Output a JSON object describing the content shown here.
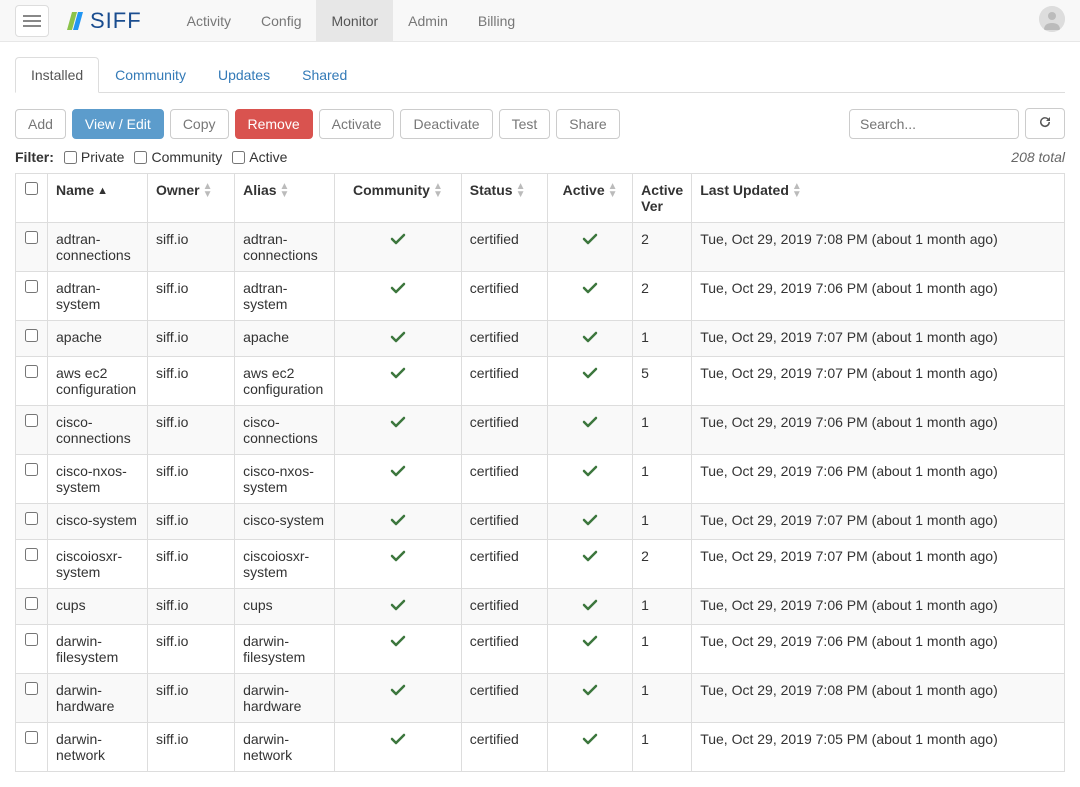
{
  "nav": {
    "items": [
      "Activity",
      "Config",
      "Monitor",
      "Admin",
      "Billing"
    ],
    "active": "Monitor",
    "brand": "SIFF"
  },
  "tabs": {
    "items": [
      "Installed",
      "Community",
      "Updates",
      "Shared"
    ],
    "active": "Installed"
  },
  "toolbar": {
    "add": "Add",
    "view_edit": "View / Edit",
    "copy": "Copy",
    "remove": "Remove",
    "activate": "Activate",
    "deactivate": "Deactivate",
    "test": "Test",
    "share": "Share",
    "search_placeholder": "Search..."
  },
  "filter": {
    "label": "Filter:",
    "private": "Private",
    "community": "Community",
    "active": "Active"
  },
  "total": "208 total",
  "columns": {
    "name": "Name",
    "owner": "Owner",
    "alias": "Alias",
    "community": "Community",
    "status": "Status",
    "active": "Active",
    "active_ver": "Active Ver",
    "last_updated": "Last Updated"
  },
  "rows": [
    {
      "name": "adtran-connections",
      "owner": "siff.io",
      "alias": "adtran-connections",
      "community": true,
      "status": "certified",
      "active": true,
      "ver": "2",
      "updated": "Tue, Oct 29, 2019 7:08 PM (about 1 month ago)"
    },
    {
      "name": "adtran-system",
      "owner": "siff.io",
      "alias": "adtran-system",
      "community": true,
      "status": "certified",
      "active": true,
      "ver": "2",
      "updated": "Tue, Oct 29, 2019 7:06 PM (about 1 month ago)"
    },
    {
      "name": "apache",
      "owner": "siff.io",
      "alias": "apache",
      "community": true,
      "status": "certified",
      "active": true,
      "ver": "1",
      "updated": "Tue, Oct 29, 2019 7:07 PM (about 1 month ago)"
    },
    {
      "name": "aws ec2 configuration",
      "owner": "siff.io",
      "alias": "aws ec2 configuration",
      "community": true,
      "status": "certified",
      "active": true,
      "ver": "5",
      "updated": "Tue, Oct 29, 2019 7:07 PM (about 1 month ago)"
    },
    {
      "name": "cisco-connections",
      "owner": "siff.io",
      "alias": "cisco-connections",
      "community": true,
      "status": "certified",
      "active": true,
      "ver": "1",
      "updated": "Tue, Oct 29, 2019 7:06 PM (about 1 month ago)"
    },
    {
      "name": "cisco-nxos-system",
      "owner": "siff.io",
      "alias": "cisco-nxos-system",
      "community": true,
      "status": "certified",
      "active": true,
      "ver": "1",
      "updated": "Tue, Oct 29, 2019 7:06 PM (about 1 month ago)"
    },
    {
      "name": "cisco-system",
      "owner": "siff.io",
      "alias": "cisco-system",
      "community": true,
      "status": "certified",
      "active": true,
      "ver": "1",
      "updated": "Tue, Oct 29, 2019 7:07 PM (about 1 month ago)"
    },
    {
      "name": "ciscoiosxr-system",
      "owner": "siff.io",
      "alias": "ciscoiosxr-system",
      "community": true,
      "status": "certified",
      "active": true,
      "ver": "2",
      "updated": "Tue, Oct 29, 2019 7:07 PM (about 1 month ago)"
    },
    {
      "name": "cups",
      "owner": "siff.io",
      "alias": "cups",
      "community": true,
      "status": "certified",
      "active": true,
      "ver": "1",
      "updated": "Tue, Oct 29, 2019 7:06 PM (about 1 month ago)"
    },
    {
      "name": "darwin-filesystem",
      "owner": "siff.io",
      "alias": "darwin-filesystem",
      "community": true,
      "status": "certified",
      "active": true,
      "ver": "1",
      "updated": "Tue, Oct 29, 2019 7:06 PM (about 1 month ago)"
    },
    {
      "name": "darwin-hardware",
      "owner": "siff.io",
      "alias": "darwin-hardware",
      "community": true,
      "status": "certified",
      "active": true,
      "ver": "1",
      "updated": "Tue, Oct 29, 2019 7:08 PM (about 1 month ago)"
    },
    {
      "name": "darwin-network",
      "owner": "siff.io",
      "alias": "darwin-network",
      "community": true,
      "status": "certified",
      "active": true,
      "ver": "1",
      "updated": "Tue, Oct 29, 2019 7:05 PM (about 1 month ago)"
    }
  ]
}
